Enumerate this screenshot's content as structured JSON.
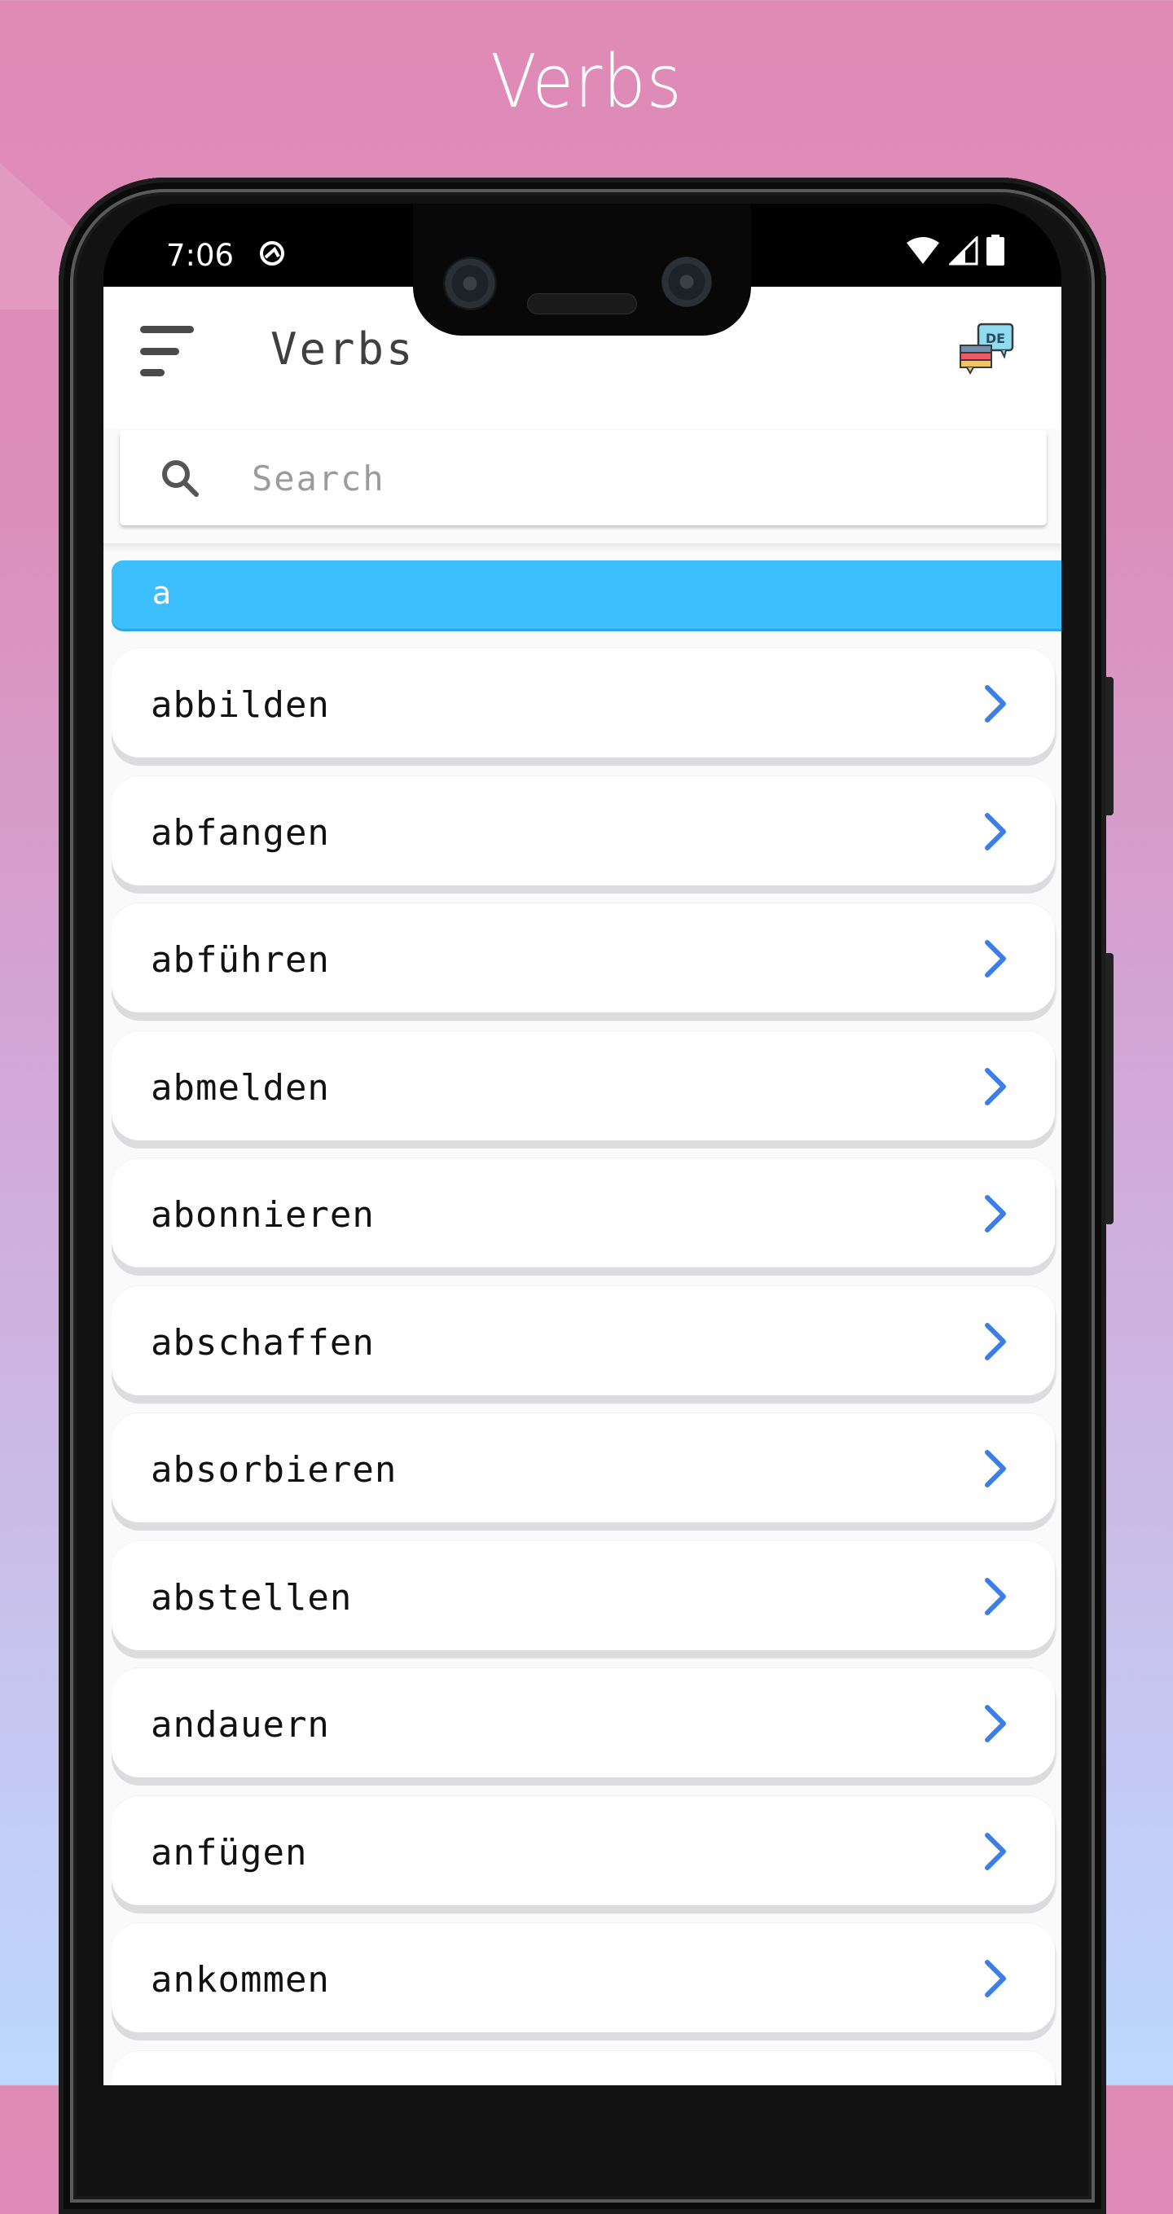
{
  "promo": {
    "title": "Verbs"
  },
  "status_bar": {
    "time": "7:06",
    "icons": [
      "assistant-icon",
      "wifi-icon",
      "signal-icon",
      "battery-icon"
    ]
  },
  "app_bar": {
    "title": "Verbs",
    "menu_icon": "menu-icon",
    "language_badge": {
      "icon": "german-flag-chat-icon",
      "text": "DE"
    }
  },
  "search": {
    "placeholder": "Search",
    "value": ""
  },
  "section": {
    "letter": "a"
  },
  "verbs": [
    {
      "label": "abbilden"
    },
    {
      "label": "abfangen"
    },
    {
      "label": "abführen"
    },
    {
      "label": "abmelden"
    },
    {
      "label": "abonnieren"
    },
    {
      "label": "abschaffen"
    },
    {
      "label": "absorbieren"
    },
    {
      "label": "abstellen"
    },
    {
      "label": "andauern"
    },
    {
      "label": "anfügen"
    },
    {
      "label": "ankommen"
    },
    {
      "label": ""
    }
  ],
  "colors": {
    "section_header": "#3ebffd",
    "chevron": "#3b7ee8",
    "title_text": "#3f3f3f"
  }
}
